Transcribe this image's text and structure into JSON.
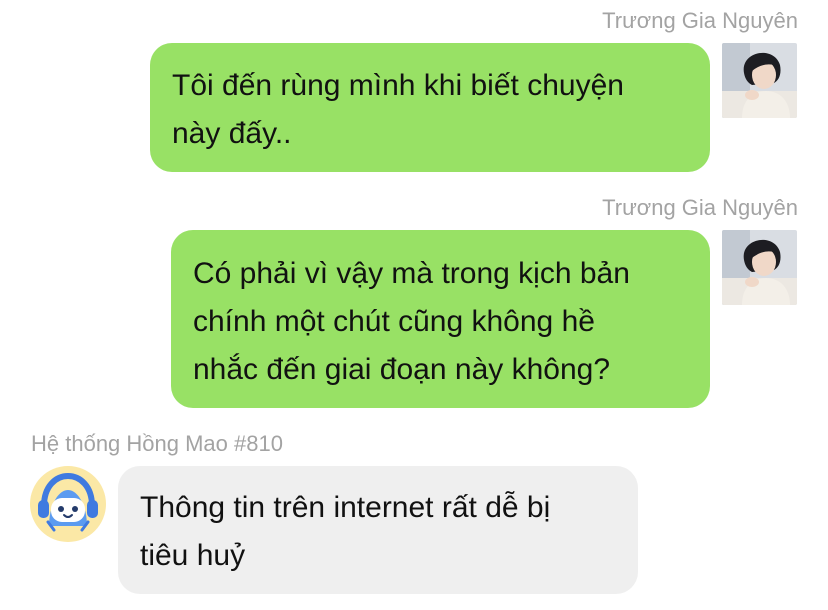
{
  "messages": [
    {
      "sender": "Trương Gia Nguyên",
      "text": "Tôi đến rùng mình khi biết chuyện\nnày đấy..",
      "direction": "outgoing",
      "avatar_icon": "user-photo-avatar"
    },
    {
      "sender": "Trương Gia Nguyên",
      "text": "Có phải vì vậy mà trong kịch bản\nchính một chút cũng không hề\nnhắc đến giai đoạn này không?",
      "direction": "outgoing",
      "avatar_icon": "user-photo-avatar"
    },
    {
      "sender": "Hệ thống Hồng Mao #810",
      "text": "Thông tin trên internet rất dễ bị\ntiêu huỷ",
      "direction": "incoming",
      "avatar_icon": "robot-mascot-avatar"
    }
  ],
  "colors": {
    "outgoing_bubble": "#98e165",
    "incoming_bubble": "#efefef",
    "sender_name": "#a3a3a3",
    "text": "#111111"
  }
}
